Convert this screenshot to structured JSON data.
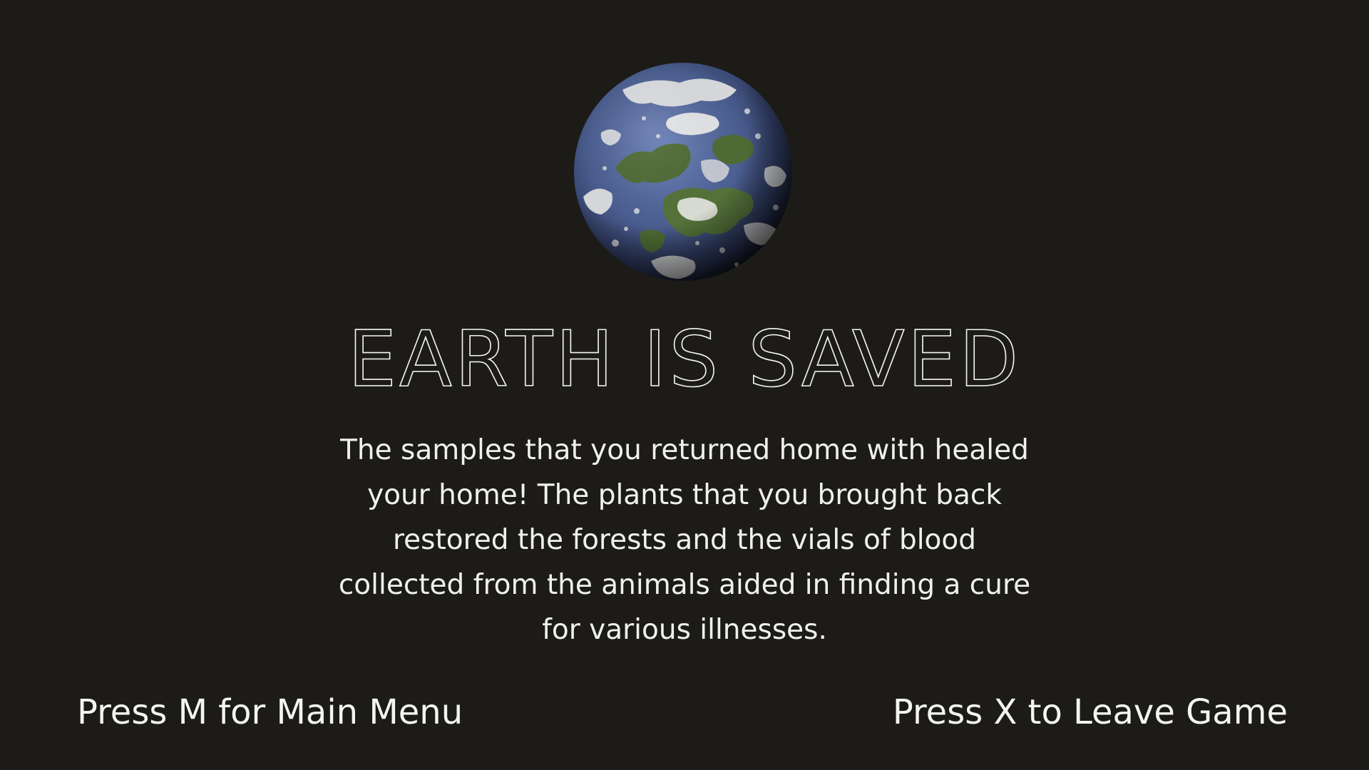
{
  "screen": {
    "background_color": "#1c1b18",
    "text_color": "#f4f4f2"
  },
  "planet": {
    "icon": "earth-globe-icon",
    "ocean_color": "#4a5d8f",
    "land_color": "#4f6b35",
    "cloud_color": "#e8e8e6"
  },
  "title": "EARTH IS SAVED",
  "story": {
    "lines": [
      "The samples that you returned home with healed",
      "your home! The plants that you brought back",
      "restored the forests and the vials of blood",
      "collected from the animals aided in finding a cure",
      "for various illnesses."
    ]
  },
  "prompts": {
    "main_menu": "Press M for Main Menu",
    "leave_game": "Press X to Leave Game"
  }
}
